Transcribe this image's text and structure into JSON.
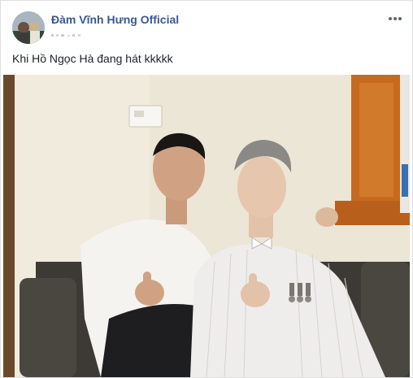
{
  "post": {
    "author_name": "Đàm Vĩnh Hưng Official",
    "caption": "Khi Hồ Ngọc Hà đang hát kkkkk",
    "icons": {
      "more": "more-options-icon",
      "privacy": "globe-icon"
    }
  },
  "colors": {
    "author_link": "#385898",
    "caption_text": "#1d2129",
    "border": "#dddfe2"
  }
}
